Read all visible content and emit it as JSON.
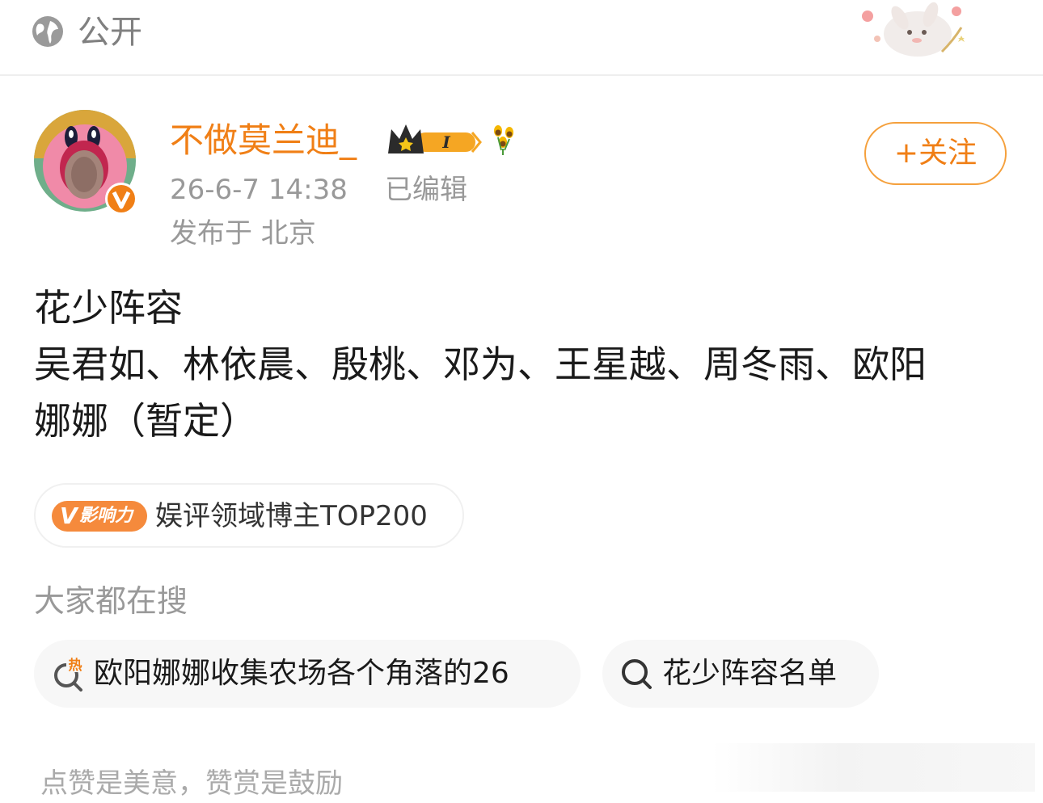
{
  "header": {
    "visibility_icon": "globe-icon",
    "visibility_label": "公开",
    "decoration": "bunny-sticker"
  },
  "post": {
    "author": {
      "name": "不做莫兰迪_",
      "avatar": "kirby-avatar",
      "verified_badge": "v-badge-icon",
      "member_badge": "crown-level-badge",
      "member_level": "I",
      "extra_icon": "sunflower-icon"
    },
    "time": "26-6-7 14:38",
    "edited": "已编辑",
    "location": "发布于 北京",
    "follow_label": "+关注",
    "content": {
      "line1": "花少阵容",
      "line2": "吴君如、林依晨、殷桃、邓为、王星越、周冬雨、欧阳",
      "line3": "娜娜（暂定）"
    },
    "influence": {
      "badge_v": "V",
      "badge_label": "影响力",
      "text": "娱评领域博主TOP200"
    }
  },
  "search_section": {
    "title": "大家都在搜",
    "items": [
      {
        "icon": "hot-search-icon",
        "hot_label": "热",
        "text": "欧阳娜娜收集农场各个角落的26"
      },
      {
        "icon": "search-icon",
        "text": "花少阵容名单"
      }
    ]
  },
  "footer": {
    "reward_text": "点赞是美意，赞赏是鼓励"
  },
  "colors": {
    "accent": "#f07f16",
    "muted": "#999999",
    "chip_bg": "#f7f7f7"
  }
}
